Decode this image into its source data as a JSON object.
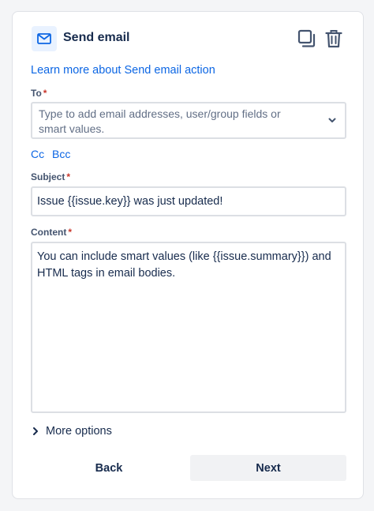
{
  "header": {
    "title": "Send email",
    "app_icon": "mail-icon",
    "actions": [
      "duplicate-icon",
      "trash-icon"
    ]
  },
  "learn_more": "Learn more about Send email action",
  "to": {
    "label": "To",
    "required_mark": "*",
    "placeholder": "Type to add email addresses, user/group fields or smart values."
  },
  "cc_label": "Cc",
  "bcc_label": "Bcc",
  "subject": {
    "label": "Subject",
    "required_mark": "*",
    "value": "Issue {{issue.key}} was just updated!"
  },
  "content": {
    "label": "Content",
    "required_mark": "*",
    "value": "You can include smart values (like {{issue.summary}}) and HTML tags in email bodies."
  },
  "more_options": "More options",
  "buttons": {
    "back": "Back",
    "next": "Next"
  },
  "colors": {
    "link": "#0c66e4",
    "required": "#c9372c",
    "text": "#172b4d",
    "icon_bg": "#e9f2ff"
  }
}
